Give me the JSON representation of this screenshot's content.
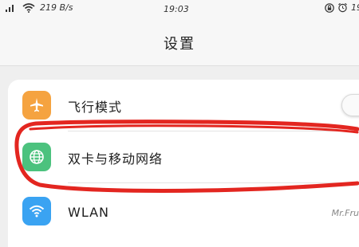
{
  "status_bar": {
    "network_speed": "219 B/s",
    "time": "19:03",
    "clipped_time": "19"
  },
  "header": {
    "title": "设置"
  },
  "settings": {
    "items": [
      {
        "label": "飞行模式",
        "icon": "airplane-icon",
        "icon_color": "#f5a340"
      },
      {
        "label": "双卡与移动网络",
        "icon": "globe-icon",
        "icon_color": "#4cc27e"
      },
      {
        "label": "WLAN",
        "icon": "wifi-icon",
        "icon_color": "#3aa3f2",
        "value": "Mr.Fru"
      }
    ]
  },
  "annotation": {
    "color": "#e32620"
  }
}
